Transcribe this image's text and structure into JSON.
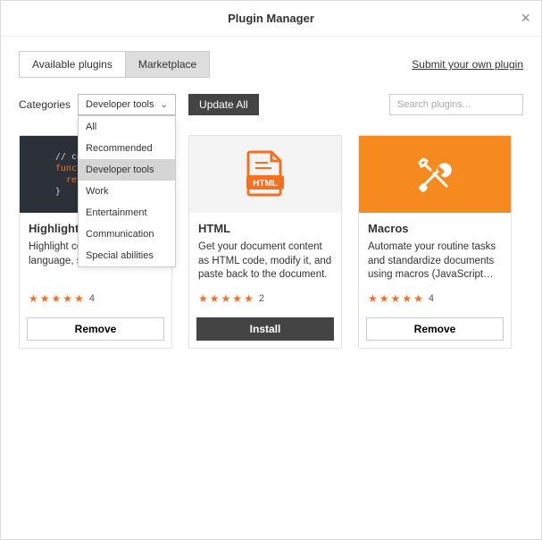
{
  "window": {
    "title": "Plugin Manager"
  },
  "tabs": {
    "available": "Available plugins",
    "marketplace": "Marketplace"
  },
  "submit_link": "Submit your own plugin",
  "categories": {
    "label": "Categories",
    "selected": "Developer tools",
    "options": [
      "All",
      "Recommended",
      "Developer tools",
      "Work",
      "Entertainment",
      "Communication",
      "Special abilities"
    ]
  },
  "update_all": "Update All",
  "search": {
    "placeholder": "Search plugins..."
  },
  "cards": [
    {
      "title": "Highlight",
      "desc": "Highlight code: selecting the language, style, and…",
      "rating": 4,
      "button": "Remove",
      "btn_kind": "remove",
      "thumb": "code"
    },
    {
      "title": "HTML",
      "desc": "Get your document content as HTML code, modify it, and paste back to the document.",
      "rating": 2,
      "button": "Install",
      "btn_kind": "install",
      "thumb": "html"
    },
    {
      "title": "Macros",
      "desc": "Automate your routine tasks and standardize documents using macros (JavaScript…",
      "rating": 4,
      "button": "Remove",
      "btn_kind": "remove",
      "thumb": "tools"
    }
  ]
}
